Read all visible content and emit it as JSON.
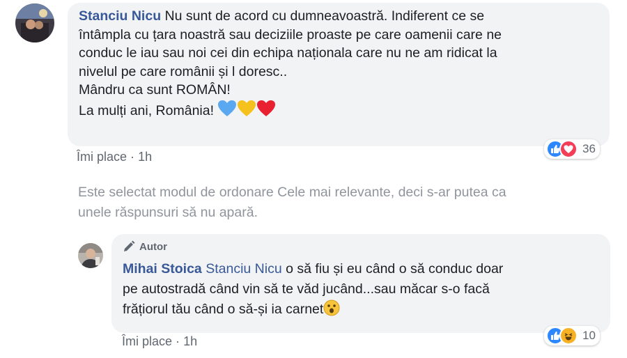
{
  "comment1": {
    "author": "Stanciu Nicu",
    "lines": [
      "Nu sunt de acord cu dumneavoastră. Indiferent ce se",
      "întâmpla cu țara noastră sau deciziile proaste pe care oamenii care ne",
      "conduc le iau sau noi cei din echipa naționala care nu ne am ridicat la",
      "nivelul pe care românii și l doresc..",
      "Mândru ca sunt ROMÂN!",
      "La mulți ani, România!"
    ],
    "emojis": [
      "blue-heart-icon",
      "yellow-heart-icon",
      "red-heart-icon"
    ],
    "like_label": "Îmi place",
    "separator": "·",
    "time": "1h",
    "reactions": [
      "like-icon",
      "love-icon"
    ],
    "reaction_count": "36"
  },
  "sort_notice": {
    "line1": "Este selectat modul de ordonare Cele mai relevante, deci s-ar putea ca",
    "line2": "unele răspunsuri să nu apară."
  },
  "reply": {
    "badge": "Autor",
    "author": "Mihai Stoica",
    "mention": "Stanciu Nicu",
    "line1_rest": " o să fiu și eu când o să conduc doar",
    "line2": "pe autostradă când vin să te văd jucând...sau măcar s-o facă",
    "line3": "frățiorul tău când o să-și ia carnet",
    "like_label": "Îmi place",
    "separator": "·",
    "time": "1h",
    "reactions": [
      "like-icon",
      "haha-icon"
    ],
    "reaction_count": "10"
  },
  "colors": {
    "name": "#385898",
    "bubble": "#f2f3f5",
    "muted": "#90949c",
    "like_blue": "#2d88ff",
    "love_red": "#f33e58",
    "haha_yellow": "#f7b125"
  }
}
